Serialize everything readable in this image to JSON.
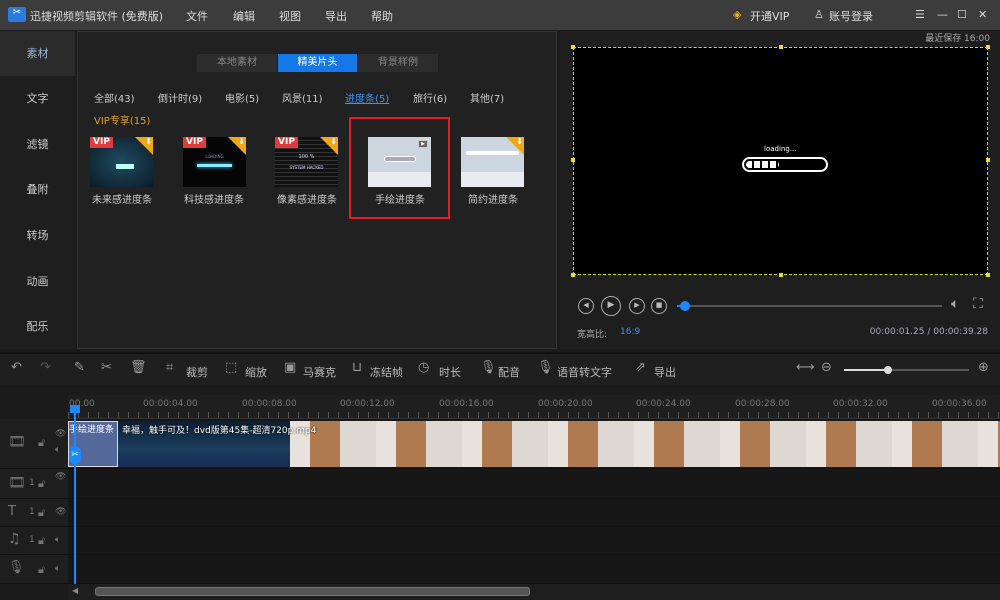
{
  "app": {
    "title": "迅捷视频剪辑软件 (免费版)",
    "menus": [
      "文件",
      "编辑",
      "视图",
      "导出",
      "帮助"
    ],
    "vip": "开通VIP",
    "account": "账号登录",
    "accent": "#1677e6"
  },
  "sidebar": [
    "素材",
    "文字",
    "滤镜",
    "叠附",
    "转场",
    "动画",
    "配乐"
  ],
  "media": {
    "tabs": [
      "本地素材",
      "精美片头",
      "背景样例"
    ],
    "categories": [
      "全部(43)",
      "倒计时(9)",
      "电影(5)",
      "风景(11)",
      "进度条(5)",
      "旅行(6)",
      "其他(7)"
    ],
    "vip_category": "VIP专享(15)",
    "items": [
      {
        "label": "未来感进度条",
        "vip": "VIP"
      },
      {
        "label": "科技感进度条",
        "vip": "VIP",
        "thumb_text": "LOADING"
      },
      {
        "label": "像素感进度条",
        "vip": "VIP",
        "thumb_text": "100 %",
        "thumb_text2": "SYSTEM HACKED"
      },
      {
        "label": "手绘进度条"
      },
      {
        "label": "简约进度条"
      }
    ]
  },
  "preview": {
    "saved": "最近保存 16:00",
    "loading_text": "loading...",
    "aspect_label": "宽高比:",
    "aspect": "16:9",
    "time": "00:00:01.25 / 00:00:39.28",
    "progress": 0.03
  },
  "toolbar": {
    "items": [
      "裁剪",
      "缩放",
      "马赛克",
      "冻结帧",
      "时长",
      "配音",
      "语音转文字",
      "导出"
    ],
    "zoom": 0.35
  },
  "timeline": {
    "start_label": "00.00",
    "ticks": [
      "00:00:04.00",
      "00:00:08.00",
      "00:00:12.00",
      "00:00:16.00",
      "00:00:20.00",
      "00:00:24.00",
      "00:00:28.00",
      "00:00:32.00",
      "00:00:36.00"
    ],
    "clip1": "手绘进度条",
    "clip2": "幸福，触手可及！dvd版第45集-超清720p.mp4",
    "track_num": "1"
  }
}
